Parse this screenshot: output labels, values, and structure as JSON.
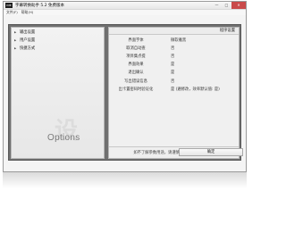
{
  "window": {
    "icon_text": "IME",
    "title": "字幕转换助手 5.2 免费版本",
    "controls": {
      "minimize": "—",
      "maximize": "□",
      "close": "✕"
    }
  },
  "menu": [
    "文件(F)",
    "帮助(H)"
  ],
  "tree": [
    {
      "label": "输出设置",
      "arrow": "▶"
    },
    {
      "label": "用户设置",
      "arrow": "▶"
    },
    {
      "label": "快捷方式",
      "arrow": "▶"
    }
  ],
  "watermark": {
    "glyph": "设",
    "text": "Options"
  },
  "panel": {
    "header": "程序设置",
    "rows": [
      {
        "label": "界面字体",
        "value": "微软雅黑"
      },
      {
        "label": "取消自动查",
        "value": "否"
      },
      {
        "label": "项目集点提",
        "value": "否"
      },
      {
        "label": "界面效果",
        "value": "是"
      },
      {
        "label": "退出确认",
        "value": "是"
      },
      {
        "label": "写出错误信息",
        "value": "否"
      },
      {
        "label": "出卡置密码时验证化",
        "value": "是 (遍修改，效率默认值: 是)"
      }
    ],
    "hint": "如不了解参数用途，请谨慎使用参数修改功能。"
  },
  "ok_button": "确定"
}
